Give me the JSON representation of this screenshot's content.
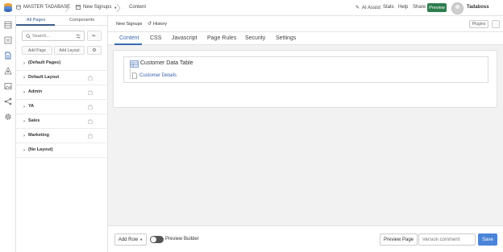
{
  "topbar": {
    "app_name": "MASTER TADABASE",
    "nav_page": "New Signups",
    "nav_current": "Content",
    "ai_assist": "AI Assist",
    "stats": "Stats",
    "help": "Help",
    "share": "Share",
    "preview": "Preview",
    "user": "Tadaboss"
  },
  "panel": {
    "tabs": [
      "All Pages",
      "Components"
    ],
    "search_placeholder": "Search...",
    "add_page": "Add Page",
    "add_layout": "Add Layout",
    "items": [
      {
        "label": "(Default Pages)",
        "locked": false
      },
      {
        "label": "Default Layout",
        "locked": true
      },
      {
        "label": "Admin",
        "locked": true
      },
      {
        "label": "YA",
        "locked": true
      },
      {
        "label": "Sales",
        "locked": true
      },
      {
        "label": "Marketing",
        "locked": true
      },
      {
        "label": "(No Layout)",
        "locked": false
      }
    ]
  },
  "main": {
    "page_name": "New Signups",
    "history": "History",
    "plugins": "Plugins",
    "tabs": [
      "Content",
      "CSS",
      "Javascript",
      "Page Rules",
      "Security",
      "Settings"
    ],
    "block_title": "Customer Data Table",
    "block_link": "Customer Details"
  },
  "bottom": {
    "add_row": "Add Row",
    "preview_builder": "Preview Builder",
    "preview_page": "Preview Page",
    "version_placeholder": "Version comment",
    "save": "Save"
  },
  "colors": {
    "accent": "#3a6bb0",
    "preview_green": "#2e7d4f",
    "save_blue": "#4a84d8"
  }
}
